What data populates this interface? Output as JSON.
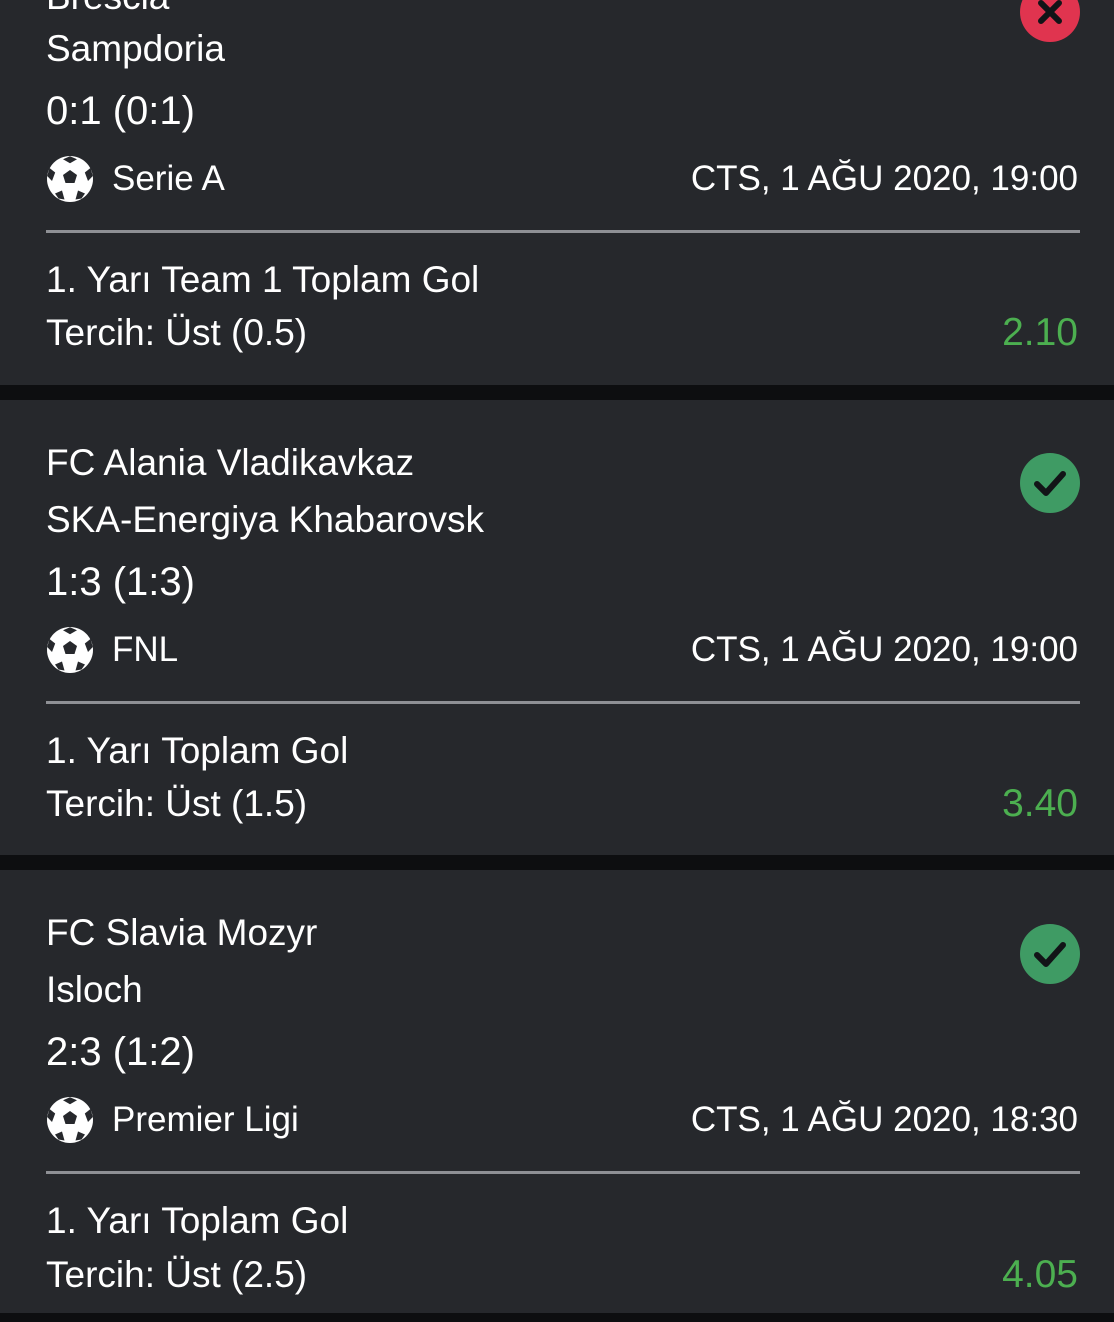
{
  "colors": {
    "background": "#0d0e10",
    "card": "#26282c",
    "text": "#ffffff",
    "divider": "#8e9095",
    "odds": "#4caf50",
    "won": "#3f9b64",
    "lost": "#e0344f"
  },
  "bets": [
    {
      "home_team": "Brescia",
      "away_team": "Sampdoria",
      "score": "0:1 (0:1)",
      "sport_icon": "soccer-ball-icon",
      "league": "Serie A",
      "datetime": "CTS, 1 AĞU 2020, 19:00",
      "market": "1. Yarı Team 1 Toplam Gol",
      "selection": "Tercih: Üst (0.5)",
      "odds": "2.10",
      "status_icon": "lost-x-icon"
    },
    {
      "home_team": "FC Alania Vladikavkaz",
      "away_team": "SKA-Energiya Khabarovsk",
      "score": "1:3 (1:3)",
      "sport_icon": "soccer-ball-icon",
      "league": "FNL",
      "datetime": "CTS, 1 AĞU 2020, 19:00",
      "market": "1. Yarı Toplam Gol",
      "selection": "Tercih: Üst (1.5)",
      "odds": "3.40",
      "status_icon": "won-check-icon"
    },
    {
      "home_team": "FC Slavia Mozyr",
      "away_team": "Isloch",
      "score": "2:3 (1:2)",
      "sport_icon": "soccer-ball-icon",
      "league": "Premier Ligi",
      "datetime": "CTS, 1 AĞU 2020, 18:30",
      "market": "1. Yarı Toplam Gol",
      "selection": "Tercih: Üst (2.5)",
      "odds": "4.05",
      "status_icon": "won-check-icon"
    }
  ]
}
